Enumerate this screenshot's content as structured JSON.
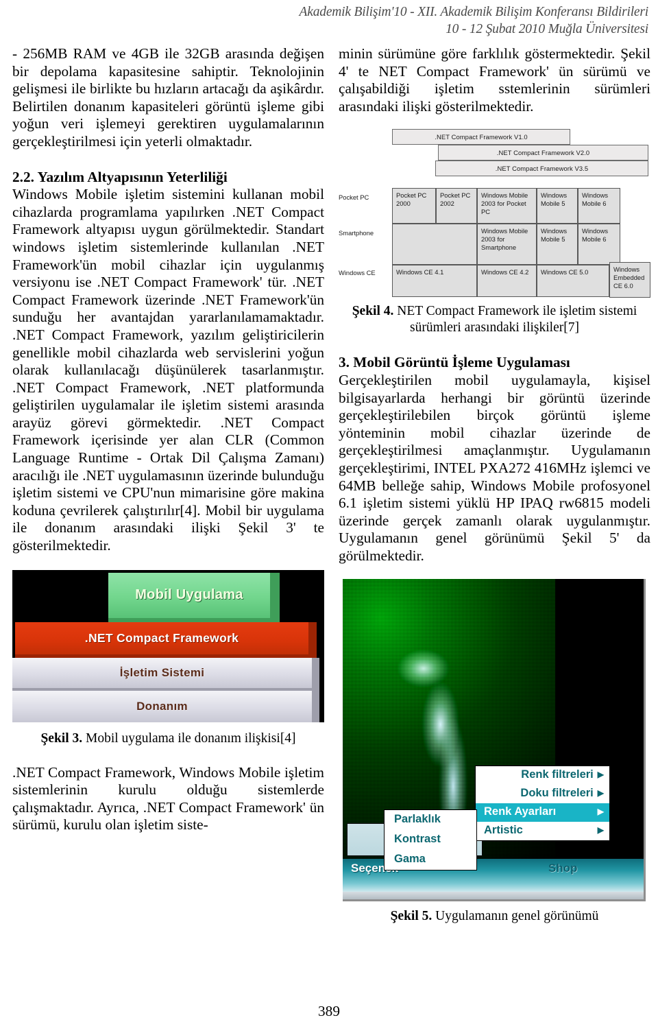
{
  "header": {
    "line1": "Akademik Bilişim'10 - XII. Akademik Bilişim Konferansı Bildirileri",
    "line2": "10 - 12 Şubat 2010  Muğla Üniversitesi"
  },
  "left_column": {
    "para_1": "- 256MB RAM ve 4GB ile 32GB arasında değişen bir depolama kapasitesine sahiptir. Teknolojinin gelişmesi ile birlikte bu hızların artacağı da aşikârdır. Belirtilen donanım kapasiteleri görüntü işleme gibi yoğun veri işlemeyi gerektiren uygulamalarının gerçekleştirilmesi için yeterli olmaktadır.",
    "heading_2_2": "2.2. Yazılım Altyapısının Yeterliliği",
    "para_2": "Windows Mobile işletim sistemini kullanan mobil cihazlarda programlama yapılırken .NET Compact Framework altyapısı uygun görülmektedir. Standart windows işletim sistemlerinde kullanılan .NET Framework'ün mobil cihazlar için uygulanmış versiyonu ise .NET Compact Framework' tür. .NET Compact Framework üzerinde .NET Framework'ün sunduğu her avantajdan yararlanılamamaktadır. .NET Compact Framework, yazılım geliştiricilerin genellikle mobil cihazlarda web servislerini yoğun olarak kullanılacağı düşünülerek tasarlanmıştır. .NET Compact Framework, .NET platformunda geliştirilen uygulamalar ile işletim sistemi arasında arayüz görevi görmektedir. .NET Compact Framework içerisinde yer alan CLR (Common Language Runtime - Ortak Dil Çalışma Zamanı) aracılığı ile .NET uygulamasının üzerinde bulunduğu işletim sistemi ve CPU'nun mimarisine göre makina koduna çevrilerek çalıştırılır[4]. Mobil bir uygulama ile donanım arasındaki ilişki Şekil 3' te gösterilmektedir.",
    "para_3": ".NET Compact Framework, Windows Mobile işletim sistemlerinin kurulu olduğu sistemlerde çalışmaktadır. Ayrıca, .NET Compact Framework' ün sürümü, kurulu olan işletim siste-"
  },
  "figure_3": {
    "caption_label": "Şekil 3.",
    "caption_text": " Mobil uygulama ile donanım ilişkisi[4]",
    "layers": [
      {
        "name": "mobile-application-layer",
        "label": "Mobil Uygulama",
        "color": "#72d68d"
      },
      {
        "name": "net-compact-framework-layer",
        "label": ".NET Compact Framework",
        "color": "#d83409"
      },
      {
        "name": "operating-system-layer",
        "label": "İşletim Sistemi",
        "color": "#dcdce6"
      },
      {
        "name": "hardware-layer",
        "label": "Donanım",
        "color": "#dcdce6"
      }
    ]
  },
  "right_column": {
    "para_1": "minin sürümüne göre farklılık göstermektedir. Şekil 4' te NET Compact Framework' ün sürümü ve çalışabildiği işletim sstemlerinin sürümleri arasındaki ilişki gösterilmektedir.",
    "heading_3": "3. Mobil Görüntü İşleme Uygulaması",
    "para_2": "Gerçekleştirilen mobil uygulamayla, kişisel bilgisayarlarda herhangi bir görüntü üzerinde gerçekleştirilebilen birçok görüntü işleme yönteminin mobil cihazlar üzerinde de gerçekleştirilmesi amaçlanmıştır. Uygulamanın gerçekleştirimi, INTEL PXA272 416MHz işlemci ve 64MB belleğe sahip,  Windows Mobile profosyonel 6.1 işletim sistemi yüklü HP IPAQ rw6815 modeli üzerinde gerçek zamanlı olarak uygulanmıştır. Uygulamanın genel görünümü Şekil 5' da görülmektedir."
  },
  "figure_4": {
    "caption_label": "Şekil 4.",
    "caption_text": " NET Compact Framework ile işletim sistemi sürümleri arasındaki ilişkiler[7]",
    "framework_bars": [
      ".NET Compact Framework V1.0",
      ".NET Compact Framework V2.0",
      ".NET Compact Framework V3.5"
    ],
    "row_labels": [
      "Pocket PC",
      "Smartphone",
      "Windows CE"
    ],
    "rows": [
      [
        "Pocket PC 2000",
        "Pocket PC 2002",
        "Windows Mobile 2003 for Pocket PC",
        "Windows Mobile 5",
        "Windows Mobile 6"
      ],
      [
        "",
        "Windows Mobile 2003 for Smartphone",
        "Windows Mobile 5",
        "Windows Mobile 6"
      ],
      [
        "Windows CE 4.1",
        "Windows CE 4.2",
        "Windows CE 5.0",
        "Windows Embedded CE 6.0"
      ]
    ]
  },
  "figure_5": {
    "caption_label": "Şekil 5.",
    "caption_text": " Uygulamanın genel görünümü",
    "commandbar": {
      "left_button": "Seçenek",
      "right_button": "Shop"
    },
    "main_menu": [
      {
        "label": "Renk filtreleri",
        "selected": false,
        "arrow": "▶"
      },
      {
        "label": "Doku filtreleri",
        "selected": false,
        "arrow": "▶"
      },
      {
        "label": "Renk Ayarları",
        "selected": true,
        "arrow": "▶"
      },
      {
        "label": "Artistic",
        "selected": false,
        "arrow": "▶"
      }
    ],
    "sub_menu": [
      {
        "label": "Parlaklık"
      },
      {
        "label": "Kontrast"
      },
      {
        "label": "Gama"
      }
    ]
  },
  "folio": "389"
}
